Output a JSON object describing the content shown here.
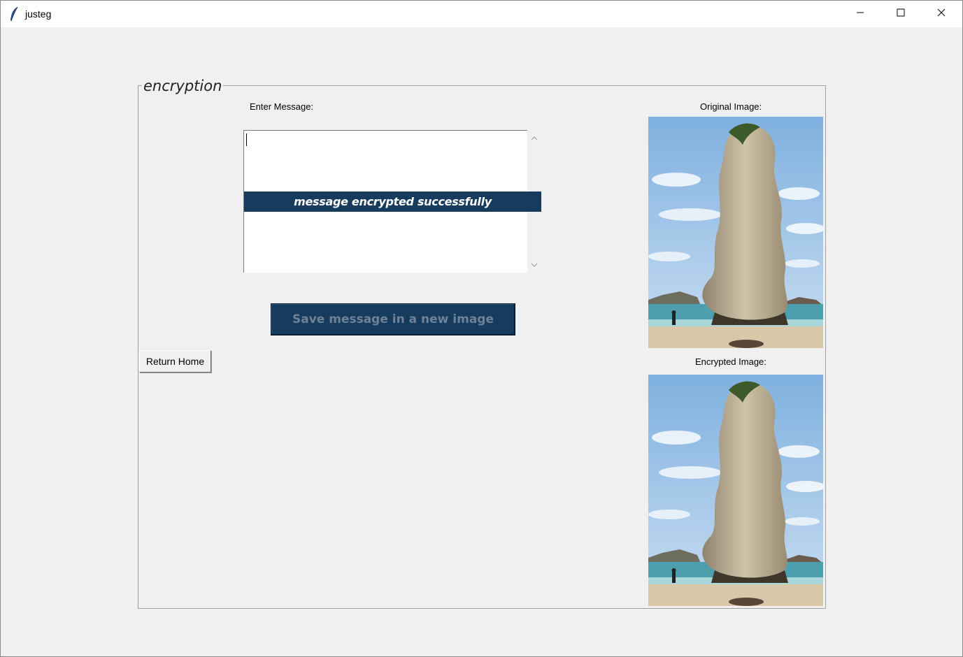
{
  "window": {
    "title": "justeg",
    "icon": "feather-icon",
    "controls": [
      "minimize-icon",
      "maximize-icon",
      "close-icon"
    ]
  },
  "frame": {
    "legend": "encryption"
  },
  "message": {
    "label": "Enter Message:",
    "value": ""
  },
  "status": {
    "banner": "message encrypted successfully"
  },
  "buttons": {
    "save": "Save message in a new image",
    "home": "Return Home"
  },
  "images": {
    "original_label": "Original Image:",
    "encrypted_label": "Encrypted Image:"
  },
  "colors": {
    "accent": "#163b5c",
    "background": "#f0f0f0"
  }
}
